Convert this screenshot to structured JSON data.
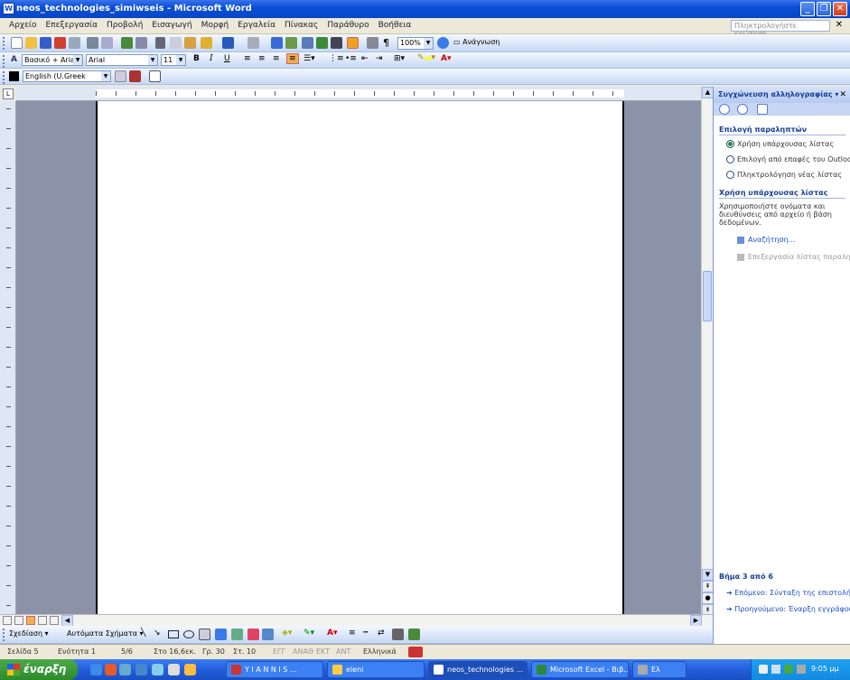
{
  "window": {
    "title": "neos_technologies_simiwseis - Microsoft Word",
    "icon": "W"
  },
  "menu": [
    "Αρχείο",
    "Επεξεργασία",
    "Προβολή",
    "Εισαγωγή",
    "Μορφή",
    "Εργαλεία",
    "Πίνακας",
    "Παράθυρο",
    "Βοήθεια"
  ],
  "help_placeholder": "Πληκτρολογήστε ερώτηση",
  "toolbar": {
    "zoom": "100%",
    "read_label": "Ανάγνωση"
  },
  "format": {
    "style": "Βασικό + Arial,",
    "font": "Arial",
    "size": "11"
  },
  "lang_bar": {
    "language": "English (U.Greek"
  },
  "taskpane": {
    "title": "Συγχώνευση αλληλογραφίας",
    "section1": "Επιλογή παραληπτών",
    "options": [
      "Χρήση υπάρχουσας λίστας",
      "Επιλογή από επαφές του Outlook",
      "Πληκτρολόγηση νέας λίστας"
    ],
    "section2": "Χρήση υπάρχουσας λίστας",
    "desc": "Χρησιμοποιήστε ονόματα και διευθύνσεις από αρχείο ή βάση δεδομένων.",
    "link_browse": "Αναζήτηση...",
    "link_edit": "Επεξεργασία λίστας παραληπτών...",
    "step": "Βήμα 3 από 6",
    "next": "Επόμενο: Σύνταξη της επιστολής",
    "prev": "Προηγούμενο: Έναρξη εγγράφου"
  },
  "drawing": {
    "draw_label": "Σχεδίαση",
    "autoshapes": "Αυτόματα Σχήματα"
  },
  "status": {
    "page": "Σελίδα 5",
    "section": "Ενότητα 1",
    "pages": "5/6",
    "at": "Στο 16,6εκ.",
    "line": "Γρ. 30",
    "col": "Στ. 10",
    "rec": "ΕΓΓ",
    "trk": "ΑΝΑΘ",
    "ext": "ΕΚΤ",
    "ovr": "ΑΝΤ",
    "lang": "Ελληνικά"
  },
  "taskbar": {
    "start": "έναρξη",
    "tasks": [
      "Y I A N N I S ...",
      "eleni",
      "neos_technologies ...",
      "Microsoft Excel - Βιβ...",
      "Eλ"
    ],
    "clock": "9:05 μμ"
  }
}
